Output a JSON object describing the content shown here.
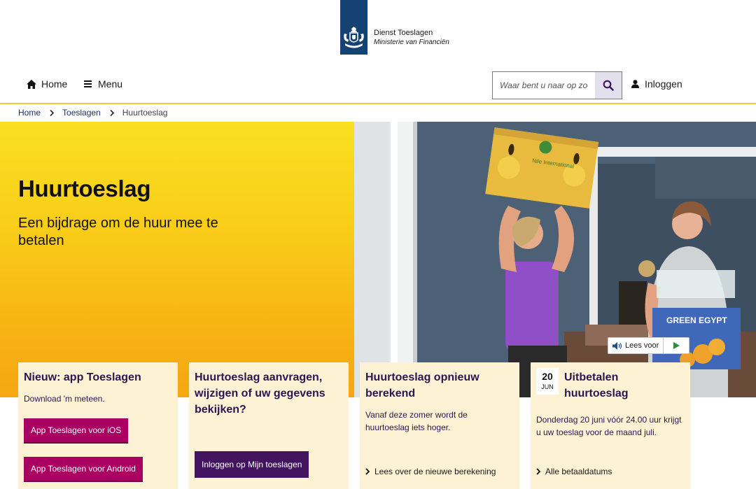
{
  "header": {
    "org_title": "Dienst Toeslagen",
    "org_subtitle": "Ministerie van Financiën"
  },
  "nav": {
    "home_label": "Home",
    "menu_label": "Menu",
    "search_placeholder": "Waar bent u naar op zoek?",
    "login_label": "Inloggen"
  },
  "breadcrumb": {
    "items": [
      "Home",
      "Toeslagen",
      "Huurtoeslag"
    ]
  },
  "hero": {
    "title": "Huurtoeslag",
    "subtitle": "Een bijdrage om de huur mee te betalen",
    "box_left_text": "Nile International",
    "box_right_text": "GREEN EGYPT"
  },
  "read_aloud": {
    "label": "Lees voor"
  },
  "cards": [
    {
      "title": "Nieuw: app Toeslagen",
      "text": "Download 'm meteen.",
      "buttons": [
        "App Toeslagen voor iOS",
        "App Toeslagen voor Android"
      ]
    },
    {
      "title": "Huurtoeslag aanvragen, wijzigen of uw gegevens bekijken?",
      "button": "Inloggen op Mijn toeslagen"
    },
    {
      "title": "Huurtoeslag opnieuw berekend",
      "text": "Vanaf deze zomer wordt de huurtoeslag iets hoger.",
      "link": "Lees over de nieuwe berekening"
    },
    {
      "date_day": "20",
      "date_month": "JUN",
      "title": "Uitbetalen huurtoeslag",
      "text": "Donderdag 20 juni vóór 24.00 uur krijgt u uw toeslag voor de maand juli.",
      "link": "Alle betaaldatums"
    }
  ],
  "colors": {
    "brand_blue": "#154273",
    "accent_yellow": "#f9c23c",
    "card_bg": "#fdf2d3",
    "button_magenta": "#a90061",
    "button_purple": "#42145f",
    "heading_purple": "#2a1650"
  }
}
